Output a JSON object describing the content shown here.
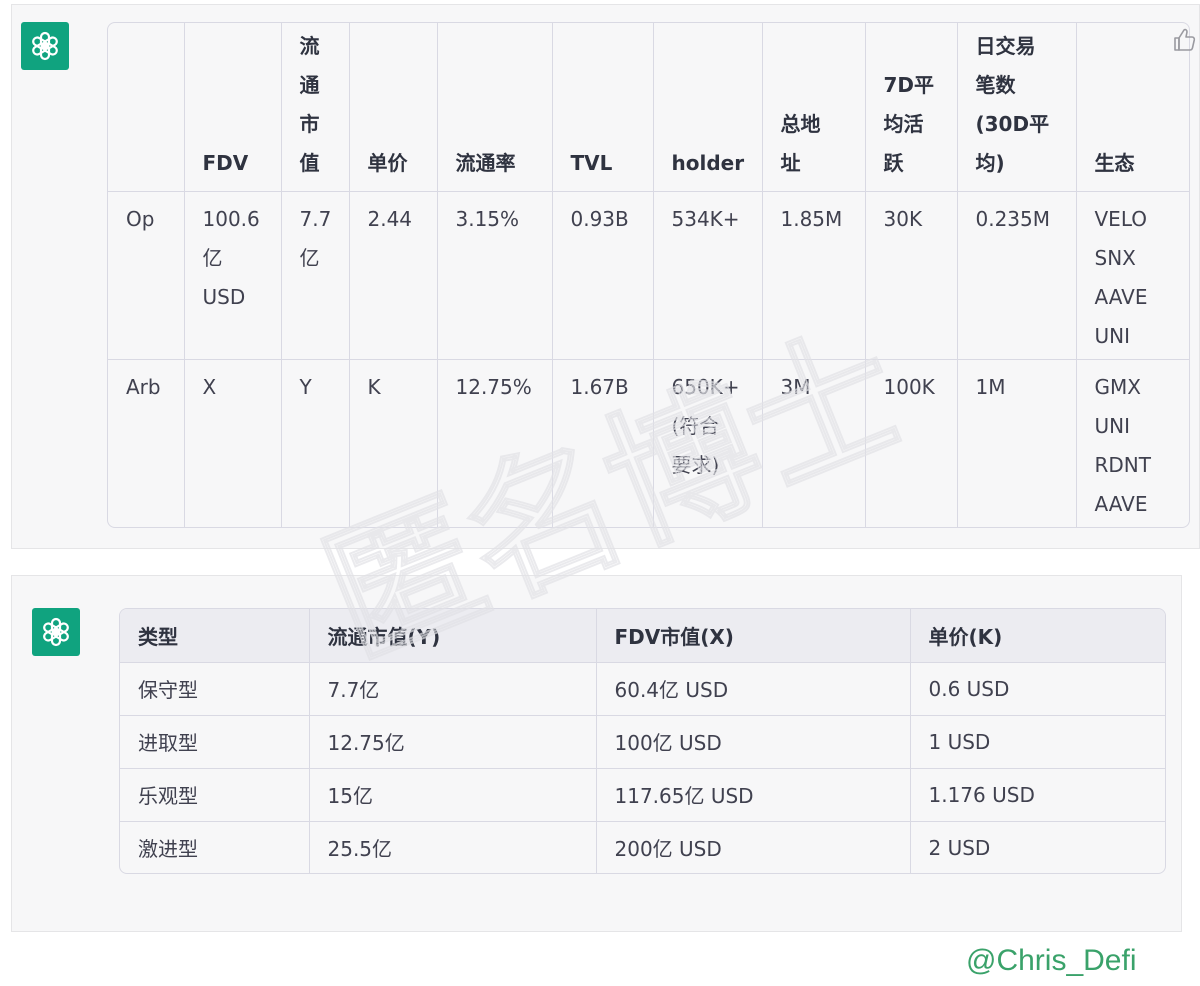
{
  "table1": {
    "headers": [
      {
        "key": "name",
        "lines": []
      },
      {
        "key": "fdv",
        "lines": [
          "FDV"
        ]
      },
      {
        "key": "circ_mcap",
        "lines": [
          "流",
          "通",
          "市",
          "值"
        ]
      },
      {
        "key": "price",
        "lines": [
          "单价"
        ]
      },
      {
        "key": "circ_rate",
        "lines": [
          "流通率"
        ]
      },
      {
        "key": "tvl",
        "lines": [
          "TVL"
        ]
      },
      {
        "key": "holder",
        "lines": [
          "holder"
        ]
      },
      {
        "key": "addresses",
        "lines": [
          "总地",
          "址"
        ]
      },
      {
        "key": "active_7d",
        "lines": [
          "7D平",
          "均活",
          "跃"
        ]
      },
      {
        "key": "daily_tx",
        "lines": [
          "日交易",
          "笔数",
          "(30D平",
          "均)"
        ]
      },
      {
        "key": "ecosystem",
        "lines": [
          "生态"
        ]
      }
    ],
    "rows": [
      {
        "name": [
          "Op"
        ],
        "fdv": [
          "100.6",
          "亿",
          "USD"
        ],
        "circ_mcap": [
          "7.7",
          "亿"
        ],
        "price": [
          "2.44"
        ],
        "circ_rate": [
          "3.15%"
        ],
        "tvl": [
          "0.93B"
        ],
        "holder": [
          "534K+"
        ],
        "addresses": [
          "1.85M"
        ],
        "active_7d": [
          "30K"
        ],
        "daily_tx": [
          "0.235M"
        ],
        "ecosystem": [
          "VELO",
          "SNX",
          "AAVE",
          "UNI"
        ]
      },
      {
        "name": [
          "Arb"
        ],
        "fdv": [
          "X"
        ],
        "circ_mcap": [
          "Y"
        ],
        "price": [
          "K"
        ],
        "circ_rate": [
          "12.75%"
        ],
        "tvl": [
          "1.67B"
        ],
        "holder": [
          "650K+",
          "(符合",
          "要求)"
        ],
        "addresses": [
          "3M"
        ],
        "active_7d": [
          "100K"
        ],
        "daily_tx": [
          "1M"
        ],
        "ecosystem": [
          "GMX",
          "UNI",
          "RDNT",
          "AAVE"
        ]
      }
    ]
  },
  "table2": {
    "headers": [
      "类型",
      "流通市值(Y)",
      "FDV市值(X)",
      "单价(K)"
    ],
    "rows": [
      [
        "保守型",
        "7.7亿",
        "60.4亿 USD",
        "0.6 USD"
      ],
      [
        "进取型",
        "12.75亿",
        "100亿 USD",
        "1 USD"
      ],
      [
        "乐观型",
        "15亿",
        "117.65亿 USD",
        "1.176 USD"
      ],
      [
        "激进型",
        "25.5亿",
        "200亿 USD",
        "2 USD"
      ]
    ]
  },
  "watermark": "匿名博士",
  "credit": "@Chris_Defi",
  "colors": {
    "avatar_bg": "#10a37f",
    "panel_bg": "#f7f7f8",
    "credit": "#3aa26a",
    "border": "#d9d9e3"
  },
  "icons": {
    "avatar": "openai-logo-icon",
    "feedback": "thumbs-up-icon"
  }
}
